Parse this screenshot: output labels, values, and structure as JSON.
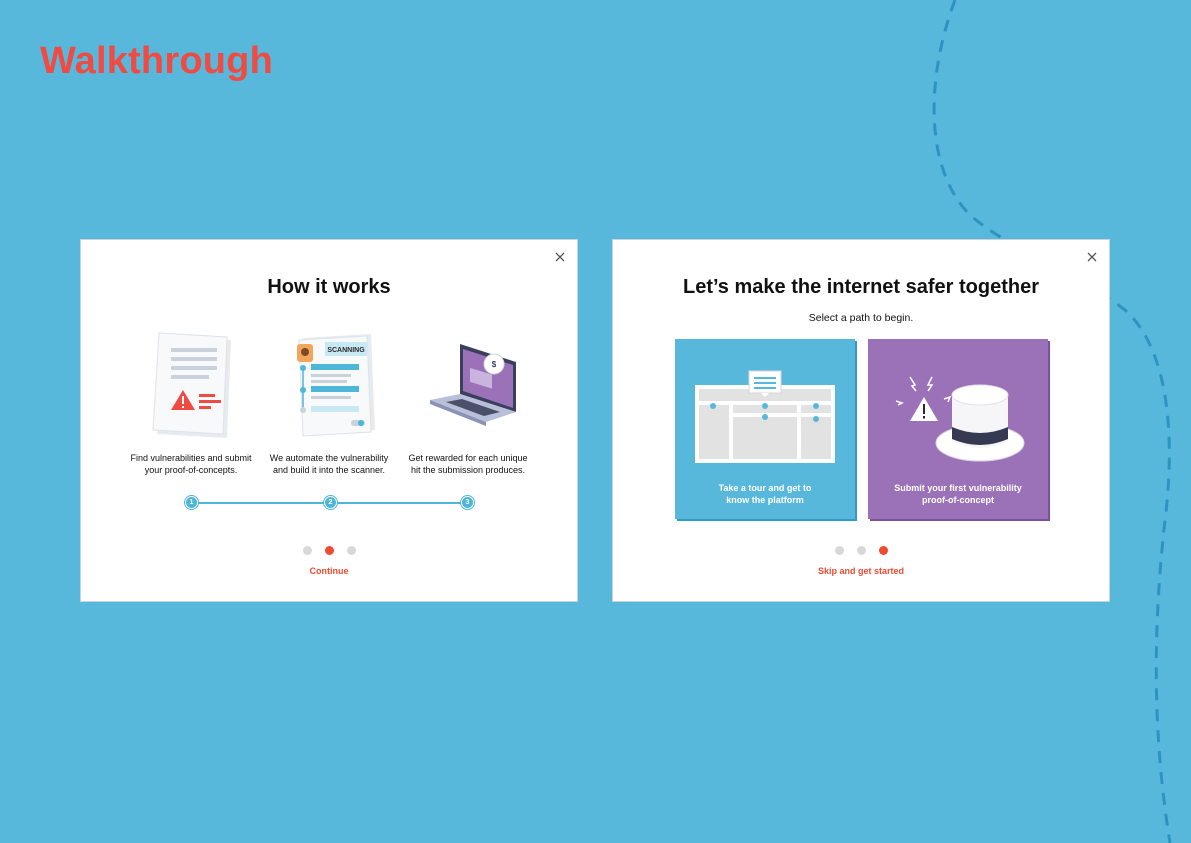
{
  "page": {
    "title": "Walkthrough"
  },
  "colors": {
    "background": "#58b8dc",
    "accent": "#ef4b30",
    "tour_card": "#58b8dc",
    "submit_card": "#9b72b8"
  },
  "how_it_works": {
    "title": "How it works",
    "steps": [
      {
        "number": "1",
        "caption": "Find vulnerabilities and submit\nyour proof-of-concepts.",
        "icon": "document-warning-icon"
      },
      {
        "number": "2",
        "caption": "We automate the vulnerability\nand build it into the scanner.",
        "icon": "scanning-icon",
        "badge": "SCANNING"
      },
      {
        "number": "3",
        "caption": "Get rewarded for each unique\nhit the submission produces.",
        "icon": "laptop-reward-icon",
        "coin": "$"
      }
    ],
    "pagination": {
      "count": 3,
      "active": 2
    },
    "continue_label": "Continue"
  },
  "choose_path": {
    "title": "Let’s make the internet safer together",
    "subtitle": "Select a path to begin.",
    "paths": [
      {
        "label": "Take a tour and get to\nknow the platform",
        "icon": "platform-tour-icon"
      },
      {
        "label": "Submit your first vulnerability\nproof-of-concept",
        "icon": "white-hat-icon"
      }
    ],
    "pagination": {
      "count": 3,
      "active": 3
    },
    "skip_label": "Skip and get started"
  }
}
